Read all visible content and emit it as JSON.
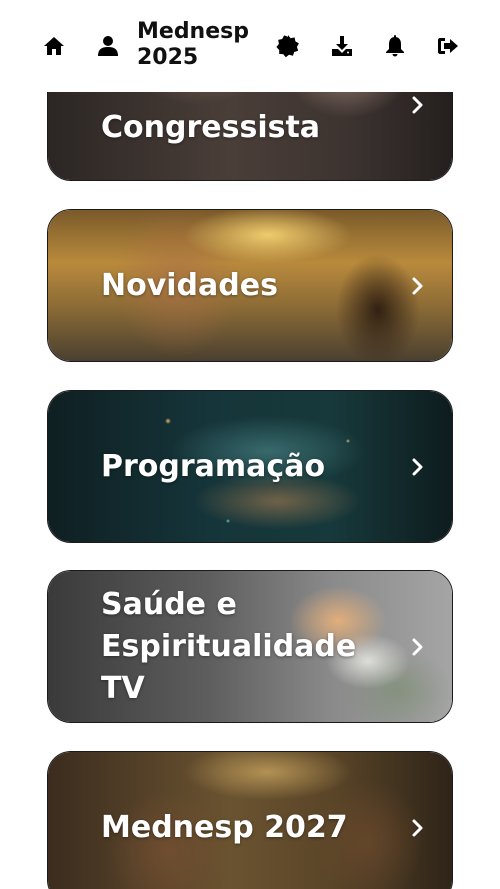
{
  "header": {
    "title_line1": "Mednesp",
    "title_line2": "2025",
    "icons": {
      "home": "home-icon",
      "user": "user-icon",
      "badge": "badge-icon",
      "download": "download-icon",
      "notifications": "bell-icon",
      "logout": "logout-icon"
    }
  },
  "menu": {
    "items": [
      {
        "label": "Guia do Congressista",
        "visible_label": "Congressista"
      },
      {
        "label": "Novidades"
      },
      {
        "label": "Programação"
      },
      {
        "label": "Saúde e Espiritualidade TV"
      },
      {
        "label": "Mednesp 2027"
      }
    ],
    "chevron_icon": "chevron-right-icon"
  },
  "colors": {
    "background": "#ffffff",
    "label_text": "#ffffff",
    "header_icons": "#000000"
  }
}
